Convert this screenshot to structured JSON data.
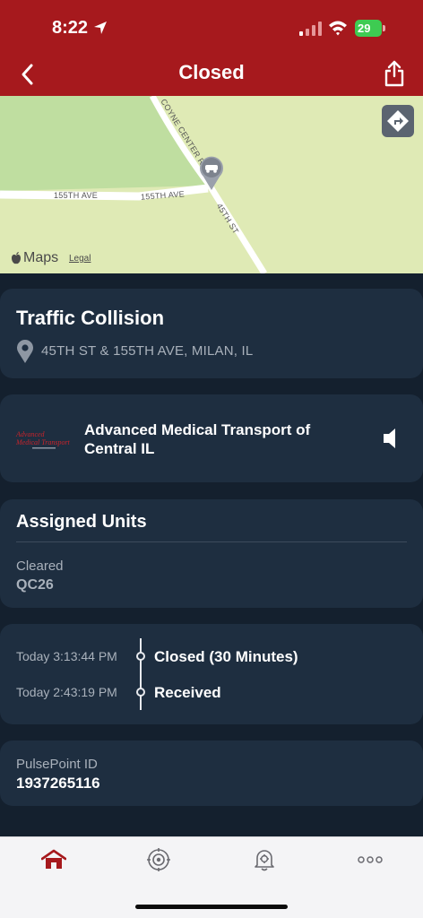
{
  "status_bar": {
    "time": "8:22",
    "battery": "29"
  },
  "header": {
    "title": "Closed",
    "back_icon": "chevron-left-icon",
    "share_icon": "share-icon"
  },
  "map": {
    "road_labels": [
      "155TH AVE",
      "155TH AVE",
      "COYNE CENTER RD",
      "45TH ST"
    ],
    "maps_label": "Maps",
    "legal_label": "Legal",
    "directions_icon": "directions-icon"
  },
  "incident": {
    "title": "Traffic Collision",
    "address": "45TH ST & 155TH AVE, MILAN, IL"
  },
  "agency": {
    "name": "Advanced Medical Transport of Central IL",
    "logo_text": "Advanced Medical Transport"
  },
  "units": {
    "title": "Assigned Units",
    "status": "Cleared",
    "unit_id": "QC26"
  },
  "timeline": [
    {
      "time": "Today 3:13:44 PM",
      "event": "Closed (30 Minutes)"
    },
    {
      "time": "Today 2:43:19 PM",
      "event": "Received"
    }
  ],
  "pulsepoint": {
    "label": "PulsePoint ID",
    "value": "1937265116"
  },
  "tabs": [
    {
      "icon": "home-icon",
      "active": true
    },
    {
      "icon": "fire-badge-icon",
      "active": false
    },
    {
      "icon": "alert-bell-icon",
      "active": false
    },
    {
      "icon": "more-icon",
      "active": false
    }
  ],
  "colors": {
    "brand_red": "#a6191d",
    "background": "#14202e",
    "card": "#1e2e40",
    "secondary_text": "#a9b1bb"
  }
}
